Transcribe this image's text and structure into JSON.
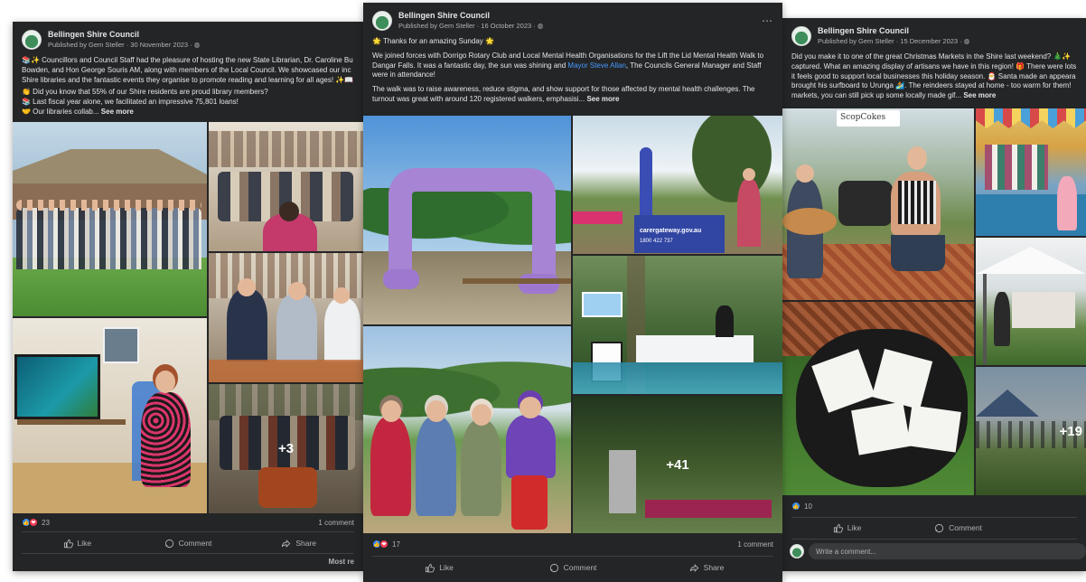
{
  "posts": {
    "left": {
      "page_name": "Bellingen Shire Council",
      "meta": "Published by Gem Steller · 30 November 2023 · ◍",
      "body": [
        "📚✨ Councillors and Council Staff had the pleasure of hosting the new State Librarian, Dr. Caroline Bu Bowden, and Hon George Souris AM, along with members of the Local Council.  We showcased our inc Shire libraries and the fantastic events they organise to promote reading and learning for all ages! ✨📖",
        "👏 Did you know that 55% of our Shire residents are proud library members?",
        "📚 Last fiscal year alone, we facilitated an impressive 75,801 loans!",
        "🤝 Our libraries collab..."
      ],
      "see_more": "See more",
      "photo_more": "+3",
      "reaction_count": "23",
      "comment_count": "1 comment",
      "actions": {
        "like": "Like",
        "comment": "Comment",
        "share": "Share"
      },
      "most_relevant": "Most re"
    },
    "center": {
      "page_name": "Bellingen Shire Council",
      "meta": "Published by Gem Steller · 16 October 2023 · ◍",
      "headline": "🌟 Thanks for an amazing Sunday 🌟",
      "body_1_a": "We joined forces with Dorrigo Rotary Club and Local Mental Health Organisations for the Lift the Lid Mental Health Walk to Dangar Falls. It was a fantastic day, the sun was shining and ",
      "body_1_link": "Mayor Steve Allan",
      "body_1_b": ", The Councils General Manager and Staff were in attendance!",
      "body_2": "The walk was to raise awareness, reduce stigma, and show support for those affected by mental health challenges. The turnout was great with around 120 registered walkers, emphasisi...",
      "see_more": "See more",
      "banner_text": "carergateway.gov.au",
      "banner_phone": "1800 422 737",
      "photo_more": "+41",
      "reaction_count": "17",
      "comment_count": "1 comment",
      "actions": {
        "like": "Like",
        "comment": "Comment",
        "share": "Share"
      }
    },
    "right": {
      "page_name": "Bellingen Shire Council",
      "meta": "Published by Gem Steller · 15 December 2023 · ◍",
      "body": "Did you make it to one of the great Christmas Markets in the Shire last weekend? 🎄✨ captured. What an amazing display of artisans we have in this region! 🎁 There were lots it feels good to support local businesses this holiday season. 🎅 Santa made an appeara brought his surfboard to Urunga 🏄. The reindeers stayed at home - too warm for them! markets, you can still pick up some locally made gif...",
      "see_more": "See more",
      "stall_sign": "ScopCokes",
      "photo_more": "+19",
      "reaction_count": "10",
      "actions": {
        "like": "Like",
        "comment": "Comment"
      },
      "comment_placeholder": "Write a comment..."
    }
  },
  "colors": {
    "card_bg": "#242526",
    "text": "#e4e6eb",
    "secondary_text": "#b0b3b8",
    "link": "#4599ff",
    "like_blue": "#2d88ff",
    "love_red": "#f33e58"
  },
  "icons": [
    "like-icon",
    "comment-icon",
    "share-icon",
    "globe-icon",
    "more-icon"
  ]
}
